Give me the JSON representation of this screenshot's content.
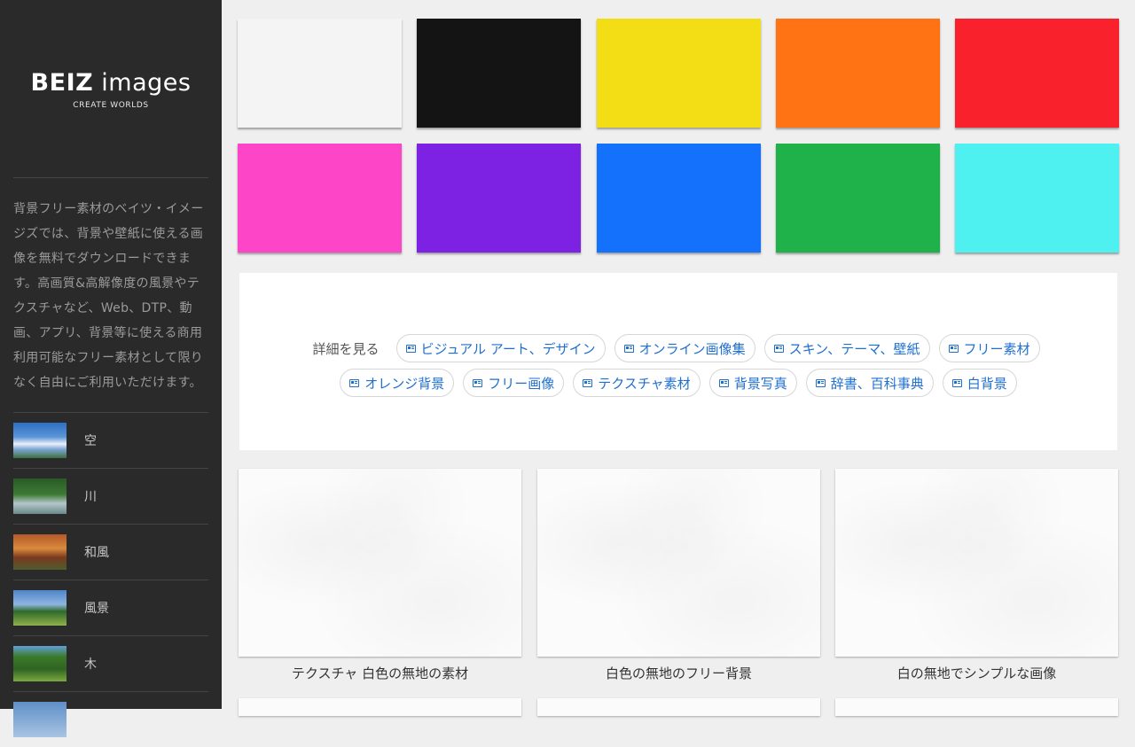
{
  "sidebar": {
    "logo": {
      "title_bold": "BEIZ",
      "title_rest": " images",
      "tagline": "CREATE WORLDS"
    },
    "intro": "背景フリー素材のベイツ・イメージズでは、背景や壁紙に使える画像を無料でダウンロードできます。高画質&高解像度の風景やテクスチャなど、Web、DTP、動画、アプリ、背景等に使える商用利用可能なフリー素材として限りなく自由にご利用いただけます。",
    "categories": [
      {
        "label": "空"
      },
      {
        "label": "川"
      },
      {
        "label": "和風"
      },
      {
        "label": "風景"
      },
      {
        "label": "木"
      }
    ]
  },
  "swatches": [
    {
      "color": "#f4f4f4"
    },
    {
      "color": "#141414"
    },
    {
      "color": "#f3de16"
    },
    {
      "color": "#ff7314"
    },
    {
      "color": "#f8212c"
    },
    {
      "color": "#fd45c8"
    },
    {
      "color": "#7d22e2"
    },
    {
      "color": "#1471fb"
    },
    {
      "color": "#20b24a"
    },
    {
      "color": "#4ef0f0"
    }
  ],
  "tags": {
    "lead": "詳細を見る",
    "row1": [
      "ビジュアル アート、デザイン",
      "オンライン画像集",
      "スキン、テーマ、壁紙",
      "フリー素材"
    ],
    "row2": [
      "オレンジ背景",
      "フリー画像",
      "テクスチャ素材",
      "背景写真",
      "辞書、百科事典",
      "白背景"
    ],
    "icon": "article-icon"
  },
  "cards": [
    {
      "caption": "テクスチャ 白色の無地の素材"
    },
    {
      "caption": "白色の無地のフリー背景"
    },
    {
      "caption": "白の無地でシンプルな画像"
    }
  ]
}
